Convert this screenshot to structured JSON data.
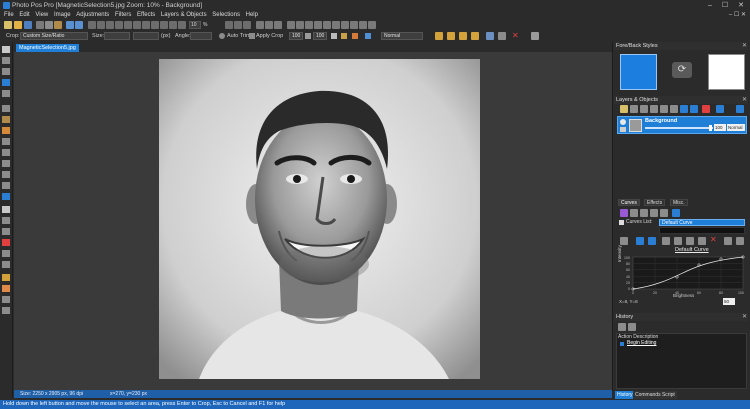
{
  "window": {
    "title": "Photo Pos Pro [MagneticSelection5.jpg Zoom: 10% - Background]",
    "controls": [
      "–",
      "☐",
      "✕"
    ]
  },
  "menu": [
    "File",
    "Edit",
    "View",
    "Image",
    "Adjustments",
    "Filters",
    "Effects",
    "Layers & Objects",
    "Selections",
    "Help"
  ],
  "toolbar": {
    "zoom_value": "10",
    "percent_label": "%"
  },
  "options_bar": {
    "crop_label": "Crop:",
    "crop_mode": "Custom Size/Ratio",
    "size_label": "Size:",
    "size_w": "",
    "size_h": "",
    "unit": "(px)",
    "angle_label": "Angle:",
    "angle_value": "",
    "auto_trim": "Auto Trim",
    "apply_crop": "Apply Crop",
    "opacity_1": "100",
    "opacity_2": "100",
    "blend_mode": "Normal"
  },
  "document": {
    "tab_label": "MagneticSelection5.jpg",
    "status_size": "Size: 2250 x 2905 px, 96 dpi",
    "status_coords": "x=270, y=230 px"
  },
  "status_bar": {
    "text": "Hold down the left button and move the mouse to select an area, press Enter to Crop, Esc to Cancel and F1 for help"
  },
  "panels": {
    "fore_back": {
      "title": "Fore/Back Styles",
      "fore_color": "#1c7fe0",
      "back_color": "#ffffff"
    },
    "layers": {
      "title": "Layers & Objects",
      "layer_name": "Background",
      "opacity": "100",
      "blend": "Normal"
    },
    "adjust_tabs": [
      "Curves",
      "Effects",
      "Misc."
    ],
    "curves": {
      "list_label": "Curves List:",
      "selected": "Default Curve",
      "chart_title": "Default Curve",
      "x_label": "Brightness",
      "y_label": "Intensity",
      "readout": "X=8, Y=8",
      "value_box": "50",
      "y_ticks": [
        "100",
        "80",
        "60",
        "40",
        "20",
        "0"
      ],
      "x_ticks": [
        "0",
        "20",
        "40",
        "60",
        "80",
        "100"
      ]
    },
    "history": {
      "title": "History",
      "header": "Action Description",
      "entries": [
        "Begin Editing"
      ]
    },
    "bottom_tabs": [
      "History",
      "Commands Script"
    ]
  },
  "colors": {
    "accent": "#1f7fd6",
    "status_bar": "#1e66bb",
    "workspace": "#3a3a3a",
    "chrome": "#2b2b2b"
  }
}
